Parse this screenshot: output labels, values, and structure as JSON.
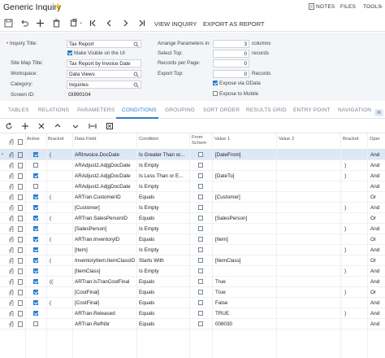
{
  "header": {
    "title": "Generic Inquiry",
    "star_color": "#f5b400",
    "notes_label": "NOTES",
    "files_label": "FILES",
    "tools_label": "TOOLS"
  },
  "toolbar": {
    "view_inquiry_label": "VIEW INQUIRY",
    "export_as_report_label": "EXPORT AS REPORT"
  },
  "form": {
    "inquiry_title_label": "Inquiry Title:",
    "inquiry_title_value": "Tax Report",
    "make_visible_label": "Make Visible on the UI",
    "site_map_title_label": "Site Map Title:",
    "site_map_title_value": "Tax Report by Invoice Date",
    "workspace_label": "Workspace:",
    "workspace_value": "Data Views",
    "category_label": "Category:",
    "category_value": "Inquiries",
    "screen_id_label": "Screen ID:",
    "screen_id_value": "GI990104",
    "arrange_label": "Arrange Parameters in:",
    "arrange_value": "3",
    "arrange_unit": "columns",
    "select_top_label": "Select Top:",
    "select_top_value": "0",
    "select_top_unit": "records",
    "records_per_page_label": "Records per Page:",
    "records_per_page_value": "0",
    "export_top_label": "Export Top:",
    "export_top_value": "0",
    "export_top_unit": "Records",
    "expose_odata_label": "Expose via OData",
    "expose_mobile_label": "Expose to Mobile"
  },
  "tabs": [
    "TABLES",
    "RELATIONS",
    "PARAMETERS",
    "CONDITIONS",
    "GROUPING",
    "SORT ORDER",
    "RESULTS GRID",
    "ENTRY POINT",
    "NAVIGATION"
  ],
  "active_tab": "CONDITIONS",
  "accent_color": "#2d7ccf",
  "grid": {
    "headers": {
      "active": "Active",
      "brackets": "Bracket",
      "data_field": "Data Field",
      "condition": "Condition",
      "from_schema_1": "From",
      "from_schema_2": "Schem",
      "value1": "Value 1",
      "value2": "Value 2",
      "brackets2": "Bracket",
      "operator": "Oper"
    },
    "rows": [
      {
        "active": true,
        "open": "(",
        "field": "ARInvoice.DocDate",
        "cond": "Is Greater Than or...",
        "from": false,
        "v1": "[DateFrom]",
        "close": "",
        "op": "And"
      },
      {
        "active": false,
        "open": "",
        "field": "ARAdjust2.AdjgDocDate",
        "cond": "Is Empty",
        "from": false,
        "v1": "",
        "close": ")",
        "op": "And"
      },
      {
        "active": true,
        "open": "",
        "field": "ARAdjust2.AdjgDocDate",
        "cond": "Is Less Than or E...",
        "from": false,
        "v1": "[DateTo]",
        "close": ")",
        "op": "And"
      },
      {
        "active": false,
        "open": "",
        "field": "ARAdjust2.AdjgDocDate",
        "cond": "Is Empty",
        "from": false,
        "v1": "",
        "close": "",
        "op": "And"
      },
      {
        "active": true,
        "open": "(",
        "field": "ARTran.CustomerID",
        "cond": "Equals",
        "from": false,
        "v1": "[Customer]",
        "close": "",
        "op": "Or"
      },
      {
        "active": true,
        "open": "",
        "field": "[Customer]",
        "cond": "Is Empty",
        "from": false,
        "v1": "",
        "close": ")",
        "op": "And"
      },
      {
        "active": true,
        "open": "(",
        "field": "ARTran.SalesPersonID",
        "cond": "Equals",
        "from": false,
        "v1": "[SalesPerson]",
        "close": "",
        "op": "Or"
      },
      {
        "active": true,
        "open": "",
        "field": "[SalesPerson]",
        "cond": "Is Empty",
        "from": false,
        "v1": "",
        "close": ")",
        "op": "And"
      },
      {
        "active": true,
        "open": "(",
        "field": "ARTran.InventoryID",
        "cond": "Equals",
        "from": false,
        "v1": "[Item]",
        "close": "",
        "op": "Or"
      },
      {
        "active": true,
        "open": "",
        "field": "[Item]",
        "cond": "Is Empty",
        "from": false,
        "v1": "",
        "close": ")",
        "op": "And"
      },
      {
        "active": true,
        "open": "(",
        "field": "InventoryItem.ItemClassID",
        "cond": "Starts With",
        "from": false,
        "v1": "[ItemClass]",
        "close": "",
        "op": "Or"
      },
      {
        "active": true,
        "open": "",
        "field": "[ItemClass]",
        "cond": "Is Empty",
        "from": false,
        "v1": "",
        "close": ")",
        "op": "And"
      },
      {
        "active": true,
        "open": "((",
        "field": "ARTran.IsTranCostFinal",
        "cond": "Equals",
        "from": false,
        "v1": "True",
        "close": "",
        "op": "And"
      },
      {
        "active": true,
        "open": "",
        "field": "[CostFinal]",
        "cond": "Equals",
        "from": false,
        "v1": "True",
        "close": ")",
        "op": "Or"
      },
      {
        "active": true,
        "open": "(",
        "field": "[CostFinal]",
        "cond": "Equals",
        "from": false,
        "v1": "False",
        "close": "",
        "op": "And"
      },
      {
        "active": true,
        "open": "",
        "field": "ARTran.Released",
        "cond": "Equals",
        "from": false,
        "v1": "TRUE",
        "close": ")",
        "op": "And"
      },
      {
        "active": false,
        "open": "",
        "field": "ARTran.RefNbr",
        "cond": "Equals",
        "from": false,
        "v1": "008030",
        "close": "",
        "op": "And"
      }
    ]
  }
}
